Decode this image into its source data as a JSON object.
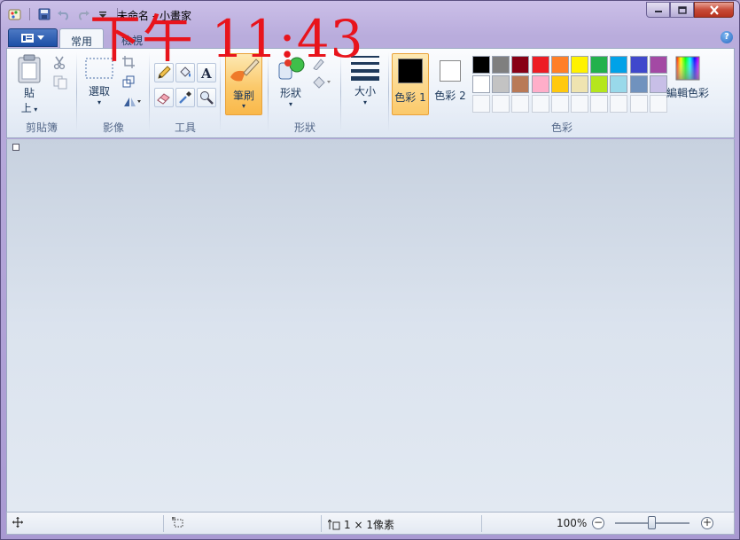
{
  "window": {
    "title": "未命名 - 小畫家",
    "overlay_clock": "下午 11:43"
  },
  "tabs": [
    {
      "label": "常用",
      "active": true
    },
    {
      "label": "檢視",
      "active": false
    }
  ],
  "ribbon": {
    "clipboard": {
      "group_label": "剪貼簿",
      "paste_label": "貼",
      "paste_sub": "上"
    },
    "image": {
      "group_label": "影像",
      "select_label": "選取"
    },
    "tools": {
      "group_label": "工具"
    },
    "brushes": {
      "label": "筆刷"
    },
    "shapes": {
      "group_label": "形狀",
      "shapes_label": "形狀"
    },
    "size": {
      "label": "大小"
    },
    "colors": {
      "group_label": "色彩",
      "color1_label": "色彩 1",
      "color2_label": "色彩 2",
      "edit_colors_label": "編輯色彩",
      "color1_value": "#000000",
      "color2_value": "#ffffff",
      "palette_row1": [
        "#000000",
        "#7f7f7f",
        "#880015",
        "#ed1c24",
        "#ff7f27",
        "#fff200",
        "#22b14c",
        "#00a2e8",
        "#3f48cc",
        "#a349a4"
      ],
      "palette_row2": [
        "#ffffff",
        "#c3c3c3",
        "#b97a57",
        "#ffaec9",
        "#ffc90e",
        "#efe4b0",
        "#b5e61d",
        "#99d9ea",
        "#7092be",
        "#c8bfe7"
      ]
    }
  },
  "status": {
    "selection_size": "1 × 1像素",
    "zoom": "100%"
  }
}
